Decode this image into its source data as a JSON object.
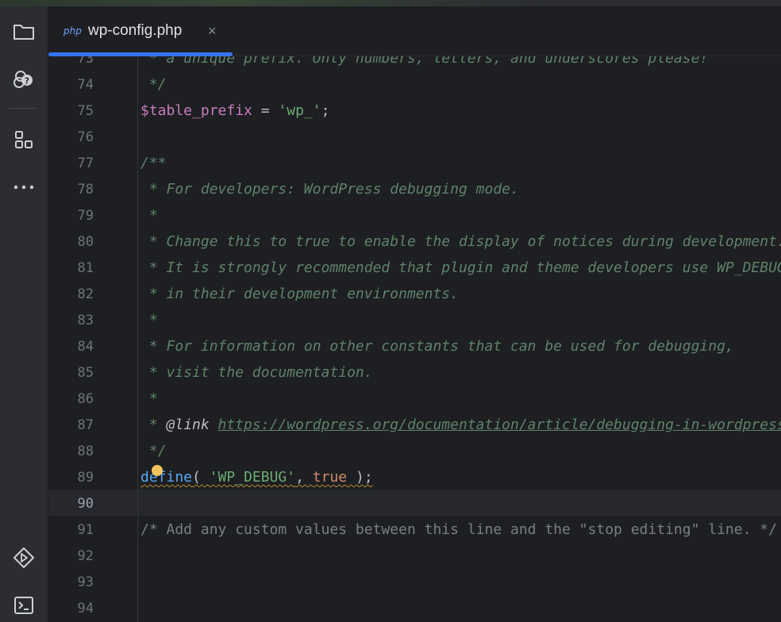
{
  "colors": {
    "accent": "#3574f0",
    "comment": "#5f826b",
    "string": "#6aab73",
    "keyword": "#cf8e6d",
    "variable": "#c77dbb",
    "function": "#56a8f5",
    "warning": "#f2c55c"
  },
  "sidebar": {
    "items": [
      {
        "icon": "folder-icon"
      },
      {
        "icon": "ai-assistant-icon"
      },
      {
        "icon": "structure-icon"
      },
      {
        "icon": "more-icon"
      },
      {
        "icon": "run-icon"
      },
      {
        "icon": "terminal-icon"
      }
    ]
  },
  "tab": {
    "file_icon": "php",
    "title": "wp-config.php",
    "close": "×"
  },
  "editor": {
    "line_numbers": [
      "73",
      "74",
      "75",
      "76",
      "77",
      "78",
      "79",
      "80",
      "81",
      "82",
      "83",
      "84",
      "85",
      "86",
      "87",
      "88",
      "89",
      "90",
      "91",
      "92",
      "93",
      "94"
    ],
    "current_line": "90",
    "lines": {
      "l73": " * a unique prefix. Only numbers, letters, and underscores please!",
      "l74": " */",
      "l75_var": "$table_prefix",
      "l75_op": " = ",
      "l75_str": "'wp_'",
      "l75_end": ";",
      "l77": "/**",
      "l78": " * For developers: WordPress debugging mode.",
      "l79": " *",
      "l80": " * Change this to true to enable the display of notices during development.",
      "l81": " * It is strongly recommended that plugin and theme developers use WP_DEBUG",
      "l82": " * in their development environments.",
      "l83": " *",
      "l84": " * For information on other constants that can be used for debugging,",
      "l85": " * visit the documentation.",
      "l86": " *",
      "l87_pre": " * ",
      "l87_tag": "@link",
      "l87_sp": " ",
      "l87_url": "https://wordpress.org/documentation/article/debugging-in-wordpress/",
      "l88": " */",
      "l89_fn": "define",
      "l89_open": "( ",
      "l89_str": "'WP_DEBUG'",
      "l89_comma": ", ",
      "l89_kw": "true",
      "l89_close": " );",
      "l91": "/* Add any custom values between this line and the \"stop editing\" line. */"
    }
  }
}
